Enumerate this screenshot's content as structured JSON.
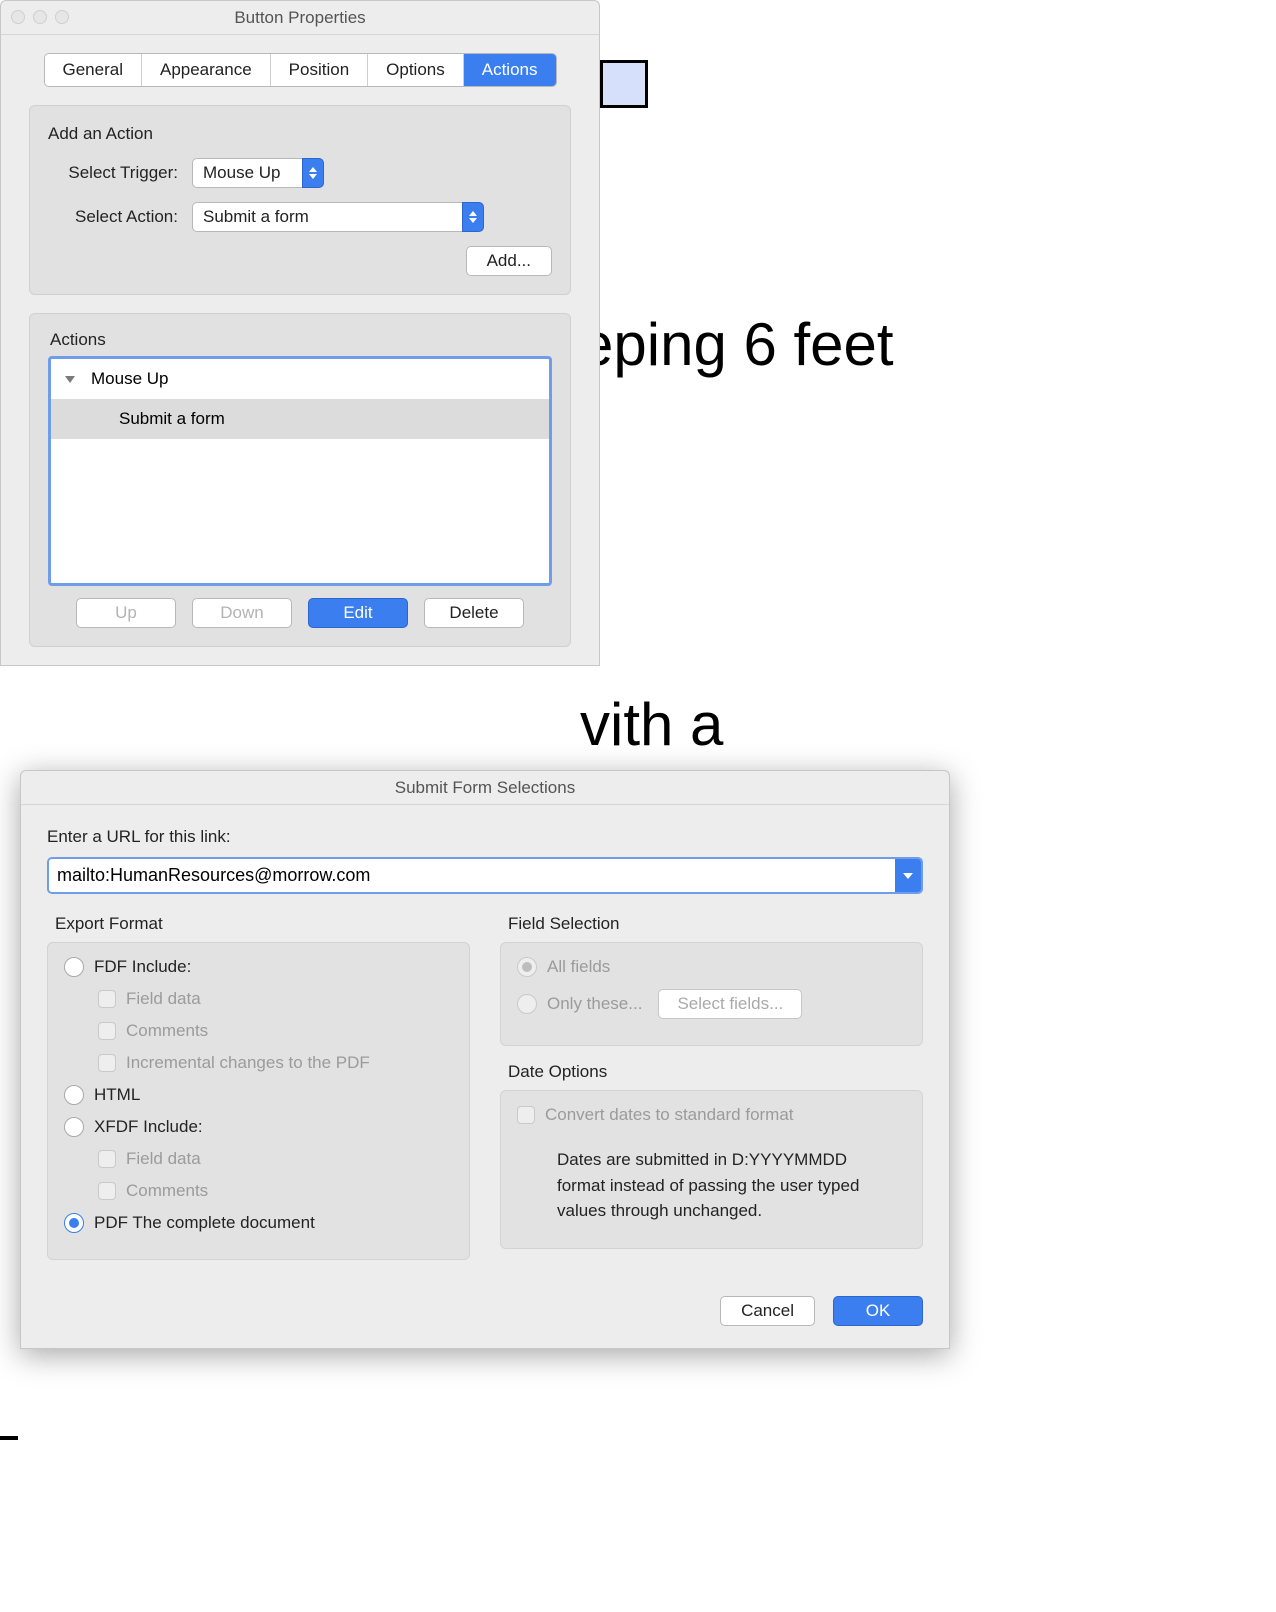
{
  "background": {
    "text1": "eping 6 feet",
    "text2": "vith a"
  },
  "win1": {
    "title": "Button Properties",
    "tabs": [
      "General",
      "Appearance",
      "Position",
      "Options",
      "Actions"
    ],
    "active_tab": "Actions",
    "add_action": {
      "heading": "Add an Action",
      "trigger_label": "Select Trigger:",
      "trigger_value": "Mouse Up",
      "action_label": "Select Action:",
      "action_value": "Submit a form",
      "add_btn": "Add..."
    },
    "actions": {
      "heading": "Actions",
      "items": [
        {
          "label": "Mouse Up",
          "expanded": true
        },
        {
          "label": "Submit a form",
          "child": true
        }
      ],
      "buttons": {
        "up": "Up",
        "down": "Down",
        "edit": "Edit",
        "delete": "Delete"
      }
    }
  },
  "win2": {
    "title": "Submit Form Selections",
    "url_label": "Enter a URL for this link:",
    "url_value": "mailto:HumanResources@morrow.com",
    "export": {
      "heading": "Export Format",
      "fdf": "FDF  Include:",
      "fdf_opts": [
        "Field data",
        "Comments",
        "Incremental changes to the PDF"
      ],
      "html": "HTML",
      "xfdf": "XFDF  Include:",
      "xfdf_opts": [
        "Field data",
        "Comments"
      ],
      "pdf": "PDF  The complete document"
    },
    "field_sel": {
      "heading": "Field Selection",
      "all": "All fields",
      "only": "Only these...",
      "select_btn": "Select fields..."
    },
    "date": {
      "heading": "Date Options",
      "convert": "Convert dates to standard format",
      "note": "Dates are submitted in D:YYYYMMDD format instead of passing the user typed values through unchanged."
    },
    "footer": {
      "cancel": "Cancel",
      "ok": "OK"
    }
  }
}
